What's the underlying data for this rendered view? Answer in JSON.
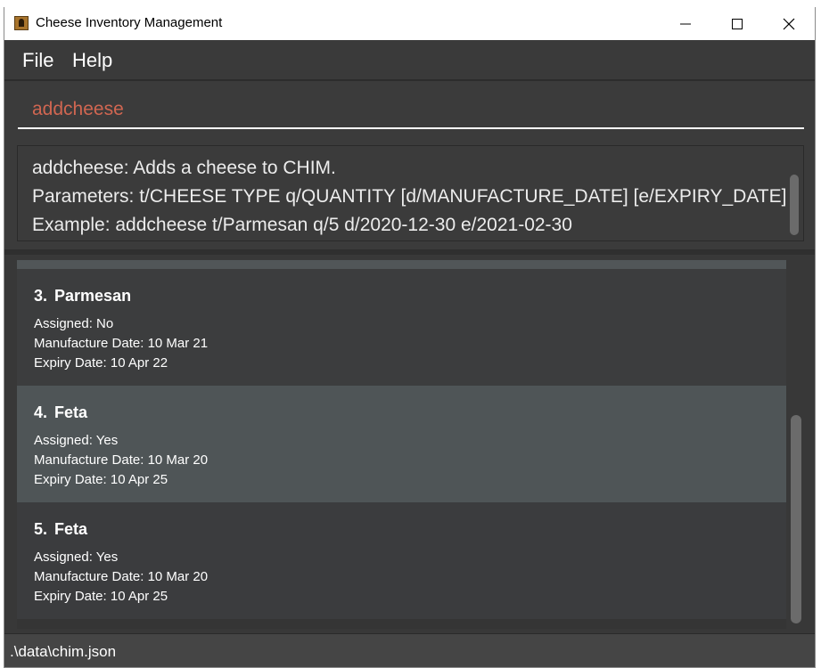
{
  "window": {
    "title": "Cheese Inventory Management",
    "controls": [
      "minimize-icon",
      "maximize-icon",
      "close-icon"
    ]
  },
  "menu": {
    "file": "File",
    "help": "Help"
  },
  "command": {
    "value": "addcheese",
    "text_color": "#d06651"
  },
  "result": {
    "lines": [
      "addcheese: Adds a cheese to CHIM.",
      "Parameters: t/CHEESE TYPE q/QUANTITY [d/MANUFACTURE_DATE] [e/EXPIRY_DATE]",
      "Example: addcheese t/Parmesan q/5 d/2020-12-30 e/2021-02-30"
    ]
  },
  "cheeses": [
    {
      "index": "3.",
      "name": "Parmesan",
      "assigned": "Assigned: No",
      "manufacture": "Manufacture Date: 10 Mar 21",
      "expiry": "Expiry Date: 10 Apr 22",
      "selected": false
    },
    {
      "index": "4.",
      "name": "Feta",
      "assigned": "Assigned: Yes",
      "manufacture": "Manufacture Date: 10 Mar 20",
      "expiry": "Expiry Date: 10 Apr 25",
      "selected": true
    },
    {
      "index": "5.",
      "name": "Feta",
      "assigned": "Assigned: Yes",
      "manufacture": "Manufacture Date: 10 Mar 20",
      "expiry": "Expiry Date: 10 Apr 25",
      "selected": false
    }
  ],
  "status": {
    "file_path": ".\\data\\chim.json"
  },
  "colors": {
    "background": "#3b3b3b",
    "selected_card": "#4f5557",
    "card": "#3c3d3e",
    "text": "#ffffff"
  }
}
